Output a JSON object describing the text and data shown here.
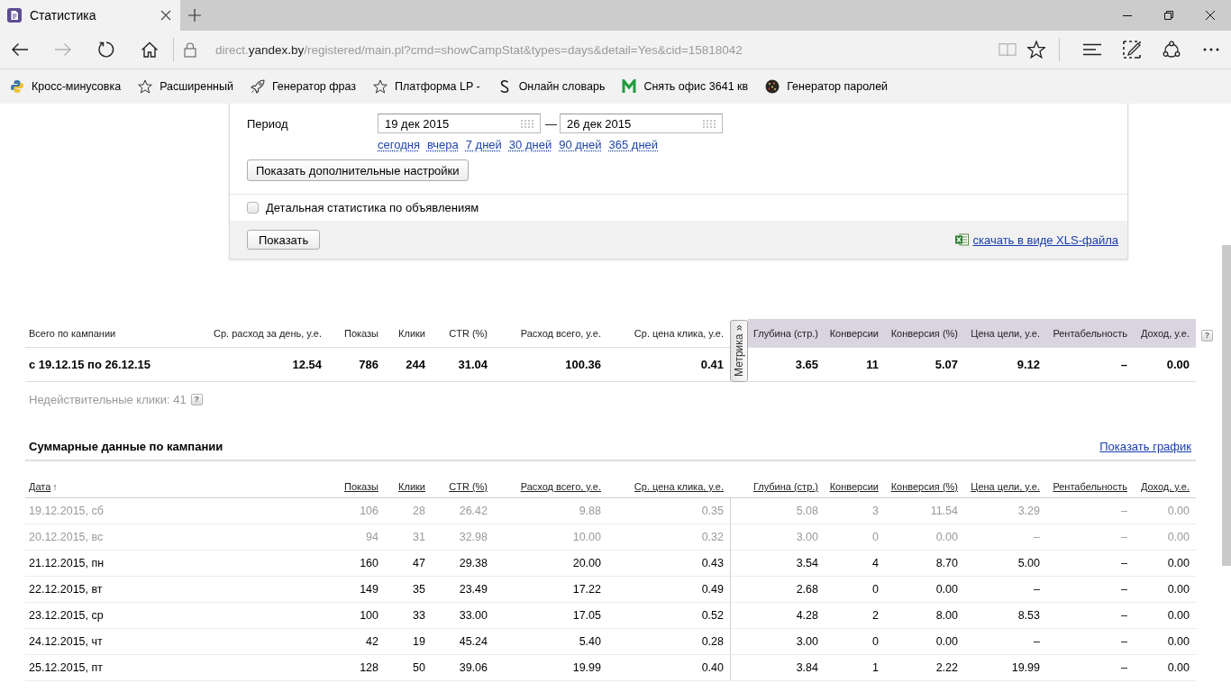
{
  "browser": {
    "tabs": [
      {
        "title": "Статистика",
        "selected": true
      }
    ],
    "back_button": {
      "disabled": false
    },
    "forward_button": {
      "disabled": true
    },
    "address": {
      "url_prefix": "direct.",
      "url_domain": "yandex.by",
      "url_path": "/registered/main.pl?cmd=showCampStat&types=days&detail=Yes&cid=15818042"
    },
    "reading_view_button": {
      "disabled": true
    },
    "bookmarks": [
      "Кросс-минусовка",
      "Расширенный",
      "Генератор фраз",
      "Платформа LP -",
      "Онлайн словарь",
      "Снять офис 3641 кв",
      "Генератор паролей"
    ]
  },
  "filter": {
    "period_label": "Период",
    "date_from": "19 дек 2015",
    "date_separator": "—",
    "date_to": "26 дек 2015",
    "presets": [
      "сегодня",
      "вчера",
      "7 дней",
      "30 дней",
      "90 дней",
      "365 дней"
    ],
    "more_settings_button": "Показать дополнительные настройки",
    "detail_checkbox": {
      "label": "Детальная статистика по объявлениям",
      "checked": false
    },
    "show_button": "Показать",
    "xls_link": "скачать в виде XLS-файла"
  },
  "summary": {
    "direct_columns": [
      "Всего по кампании",
      "Ср. расход за день, у.е.",
      "Показы",
      "Клики",
      "CTR (%)",
      "Расход всего, у.е.",
      "Ср. цена клика, у.е."
    ],
    "metrika_tab": "Метрика »",
    "metrika_columns": [
      "Глубина (стр.)",
      "Конверсии",
      "Конверсия (%)",
      "Цена цели, у.е.",
      "Рентабельность",
      "Доход, у.е."
    ],
    "help_mark": "?",
    "total_row": {
      "direct": [
        "с 19.12.15 по 26.12.15",
        "12.54",
        "786",
        "244",
        "31.04",
        "100.36",
        "0.41"
      ],
      "metrika": [
        "3.65",
        "11",
        "5.07",
        "9.12",
        "–",
        "0.00"
      ]
    },
    "invalid_clicks": "Недействительные клики: 41",
    "invalid_clicks_help": "?"
  },
  "daily": {
    "title": "Суммарные данные по кампании",
    "chart_link": "Показать график",
    "direct_columns": [
      {
        "label": "Дата",
        "sort_mark": "↑"
      },
      {
        "label": "Показы"
      },
      {
        "label": "Клики"
      },
      {
        "label": "CTR (%)"
      },
      {
        "label": "Расход всего, у.е."
      },
      {
        "label": "Ср. цена клика, у.е."
      }
    ],
    "metrika_columns": [
      {
        "label": "Глубина (стр.)"
      },
      {
        "label": "Конверсии"
      },
      {
        "label": "Конверсия (%)"
      },
      {
        "label": "Цена цели, у.е."
      },
      {
        "label": "Рентабельность"
      },
      {
        "label": "Доход, у.е."
      }
    ],
    "rows": [
      {
        "dimmed": true,
        "direct": [
          "19.12.2015, сб",
          "106",
          "28",
          "26.42",
          "9.88",
          "0.35"
        ],
        "metrika": [
          "5.08",
          "3",
          "11.54",
          "3.29",
          "–",
          "0.00"
        ]
      },
      {
        "dimmed": true,
        "direct": [
          "20.12.2015, вс",
          "94",
          "31",
          "32.98",
          "10.00",
          "0.32"
        ],
        "metrika": [
          "3.00",
          "0",
          "0.00",
          "–",
          "–",
          "0.00"
        ]
      },
      {
        "dimmed": false,
        "direct": [
          "21.12.2015, пн",
          "160",
          "47",
          "29.38",
          "20.00",
          "0.43"
        ],
        "metrika": [
          "3.54",
          "4",
          "8.70",
          "5.00",
          "–",
          "0.00"
        ]
      },
      {
        "dimmed": false,
        "direct": [
          "22.12.2015, вт",
          "149",
          "35",
          "23.49",
          "17.22",
          "0.49"
        ],
        "metrika": [
          "2.68",
          "0",
          "0.00",
          "–",
          "–",
          "0.00"
        ]
      },
      {
        "dimmed": false,
        "direct": [
          "23.12.2015, ср",
          "100",
          "33",
          "33.00",
          "17.05",
          "0.52"
        ],
        "metrika": [
          "4.28",
          "2",
          "8.00",
          "8.53",
          "–",
          "0.00"
        ]
      },
      {
        "dimmed": false,
        "direct": [
          "24.12.2015, чт",
          "42",
          "19",
          "45.24",
          "5.40",
          "0.28"
        ],
        "metrika": [
          "3.00",
          "0",
          "0.00",
          "–",
          "–",
          "0.00"
        ]
      },
      {
        "dimmed": false,
        "direct": [
          "25.12.2015, пт",
          "128",
          "50",
          "39.06",
          "19.99",
          "0.40"
        ],
        "metrika": [
          "3.84",
          "1",
          "2.22",
          "19.99",
          "–",
          "0.00"
        ]
      }
    ]
  }
}
